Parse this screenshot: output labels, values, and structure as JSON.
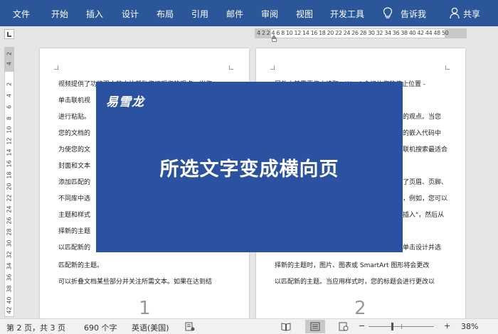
{
  "ribbon": {
    "tabs": [
      "文件",
      "开始",
      "插入",
      "设计",
      "布局",
      "引用",
      "邮件",
      "审阅",
      "视图",
      "开发工具"
    ],
    "tell_me": "告诉我",
    "share": "共享",
    "tell_me_icon": "lightbulb-icon",
    "share_icon": "person-icon"
  },
  "ruler": {
    "ticks": "4  2     2   4   6   8  10 12 14 16 18 20 22 24 26 28 30 32 34 36 38 40 42 44     48 50",
    "vertical_ticks": [
      "2",
      "4",
      "2",
      "4",
      "6",
      "8",
      "10",
      "12",
      "14",
      "16",
      "18",
      "20",
      "22",
      "24",
      "26",
      "28",
      "30",
      "32",
      "34",
      "36",
      "38",
      "40",
      "42"
    ]
  },
  "page1": {
    "lines": [
      "视频提供了功能强大的方法帮助您证明您的观点。当您",
      "单击联机视",
      "进行粘贴。",
      "您的文档的",
      "为使您的文",
      "封面和文本",
      "添加匹配的",
      "不同库中选",
      "主题和样式",
      "择新的主题",
      "以匹配新的",
      "匹配新的主题。",
      "可以折叠文档某些部分并关注所需文本。如果在达到结"
    ],
    "page_number": "1"
  },
  "page2": {
    "lines": [
      "尾处之前需要停止读取，Word 会记住您的停止位置 -",
      "",
      "的观点。当您",
      "的嵌入代码中",
      "联机搜索最适合",
      "",
      "了页眉、页脚、",
      "，例如，您可以",
      "插入\"，然后从",
      "",
      "单击设计并选",
      "择新的主题时，图片、图表或 SmartArt 图形将会更改",
      "以匹配新的主题。当应用样式时，您的标题会进行更改以"
    ],
    "page_number": "2"
  },
  "banner": {
    "logo": "易雪龙",
    "headline": "所选文字变成横向页",
    "color": "#2b52a0"
  },
  "status": {
    "page_info": "第 2 页，共 3 页",
    "word_count": "690 个字",
    "language": "英语(美国)",
    "minus": "−",
    "plus": "+",
    "zoom": "38%"
  },
  "colors": {
    "ribbon": "#2b579a",
    "workspace": "#e6e6e6"
  }
}
